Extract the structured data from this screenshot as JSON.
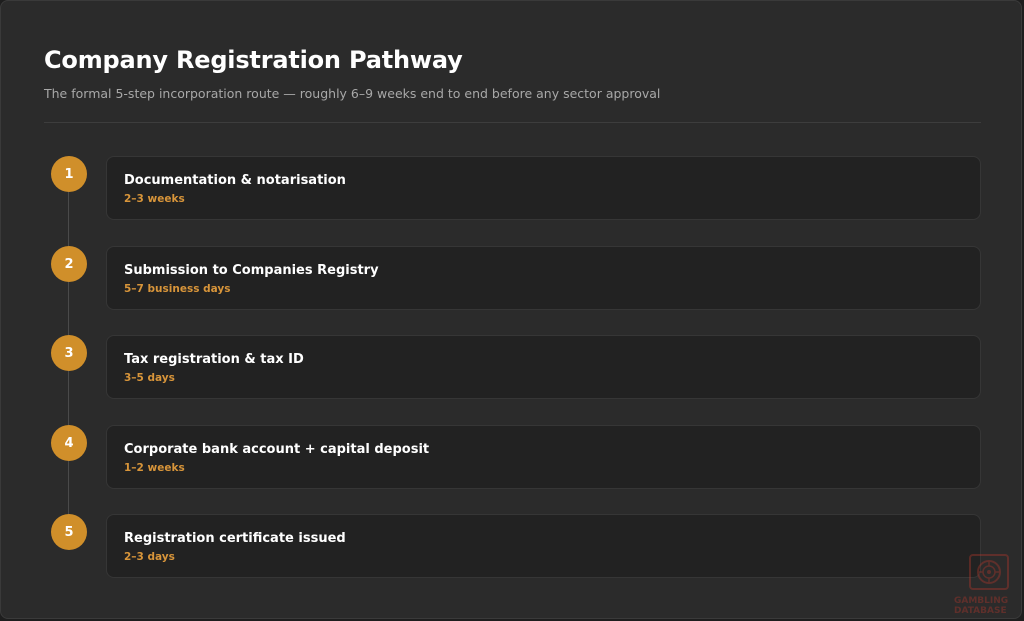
{
  "header": {
    "title": "Company Registration Pathway",
    "subtitle": "The formal 5-step incorporation route — roughly 6–9 weeks end to end before any sector approval"
  },
  "steps": [
    {
      "number": "1",
      "name": "Documentation & notarisation",
      "duration": "2–3 weeks"
    },
    {
      "number": "2",
      "name": "Submission to Companies Registry",
      "duration": "5–7 business days"
    },
    {
      "number": "3",
      "name": "Tax registration & tax ID",
      "duration": "3–5 days"
    },
    {
      "number": "4",
      "name": "Corporate bank account + capital deposit",
      "duration": "1–2 weeks"
    },
    {
      "number": "5",
      "name": "Registration certificate issued",
      "duration": "2–3 days"
    }
  ],
  "watermark": {
    "line1": "GAMBLING",
    "line2": "DATABASE",
    "icon": "roulette-wheel-icon",
    "color": "#c0392b"
  },
  "colors": {
    "accent": "#d08f2a",
    "duration_text": "#d8953a",
    "panel_bg": "#2b2b2b",
    "card_bg": "#222222"
  }
}
